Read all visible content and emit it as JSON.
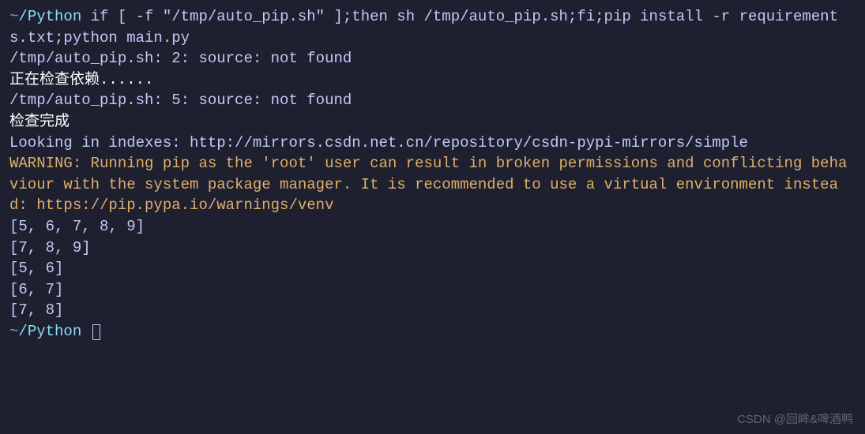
{
  "prompt1": {
    "tilde": "~",
    "slash": "/",
    "dir": "Python",
    "cmd": " if [ -f \"/tmp/auto_pip.sh\" ];then sh /tmp/auto_pip.sh;fi;pip install -r requirements.txt;python main.py"
  },
  "output": {
    "line1": "/tmp/auto_pip.sh: 2: source: not found",
    "line2": "正在检查依赖......",
    "line3": "/tmp/auto_pip.sh: 5: source: not found",
    "line4": "检查完成",
    "line5": "Looking in indexes: http://mirrors.csdn.net.cn/repository/csdn-pypi-mirrors/simple",
    "warning": "WARNING: Running pip as the 'root' user can result in broken permissions and conflicting behaviour with the system package manager. It is recommended to use a virtual environment instead: https://pip.pypa.io/warnings/venv",
    "arr1": "[5, 6, 7, 8, 9]",
    "arr2": "[7, 8, 9]",
    "arr3": "[5, 6]",
    "arr4": "[6, 7]",
    "arr5": "[7, 8]"
  },
  "prompt2": {
    "tilde": "~",
    "slash": "/",
    "dir": "Python",
    "space": " "
  },
  "watermark": "CSDN @回眸&啤酒鸭"
}
